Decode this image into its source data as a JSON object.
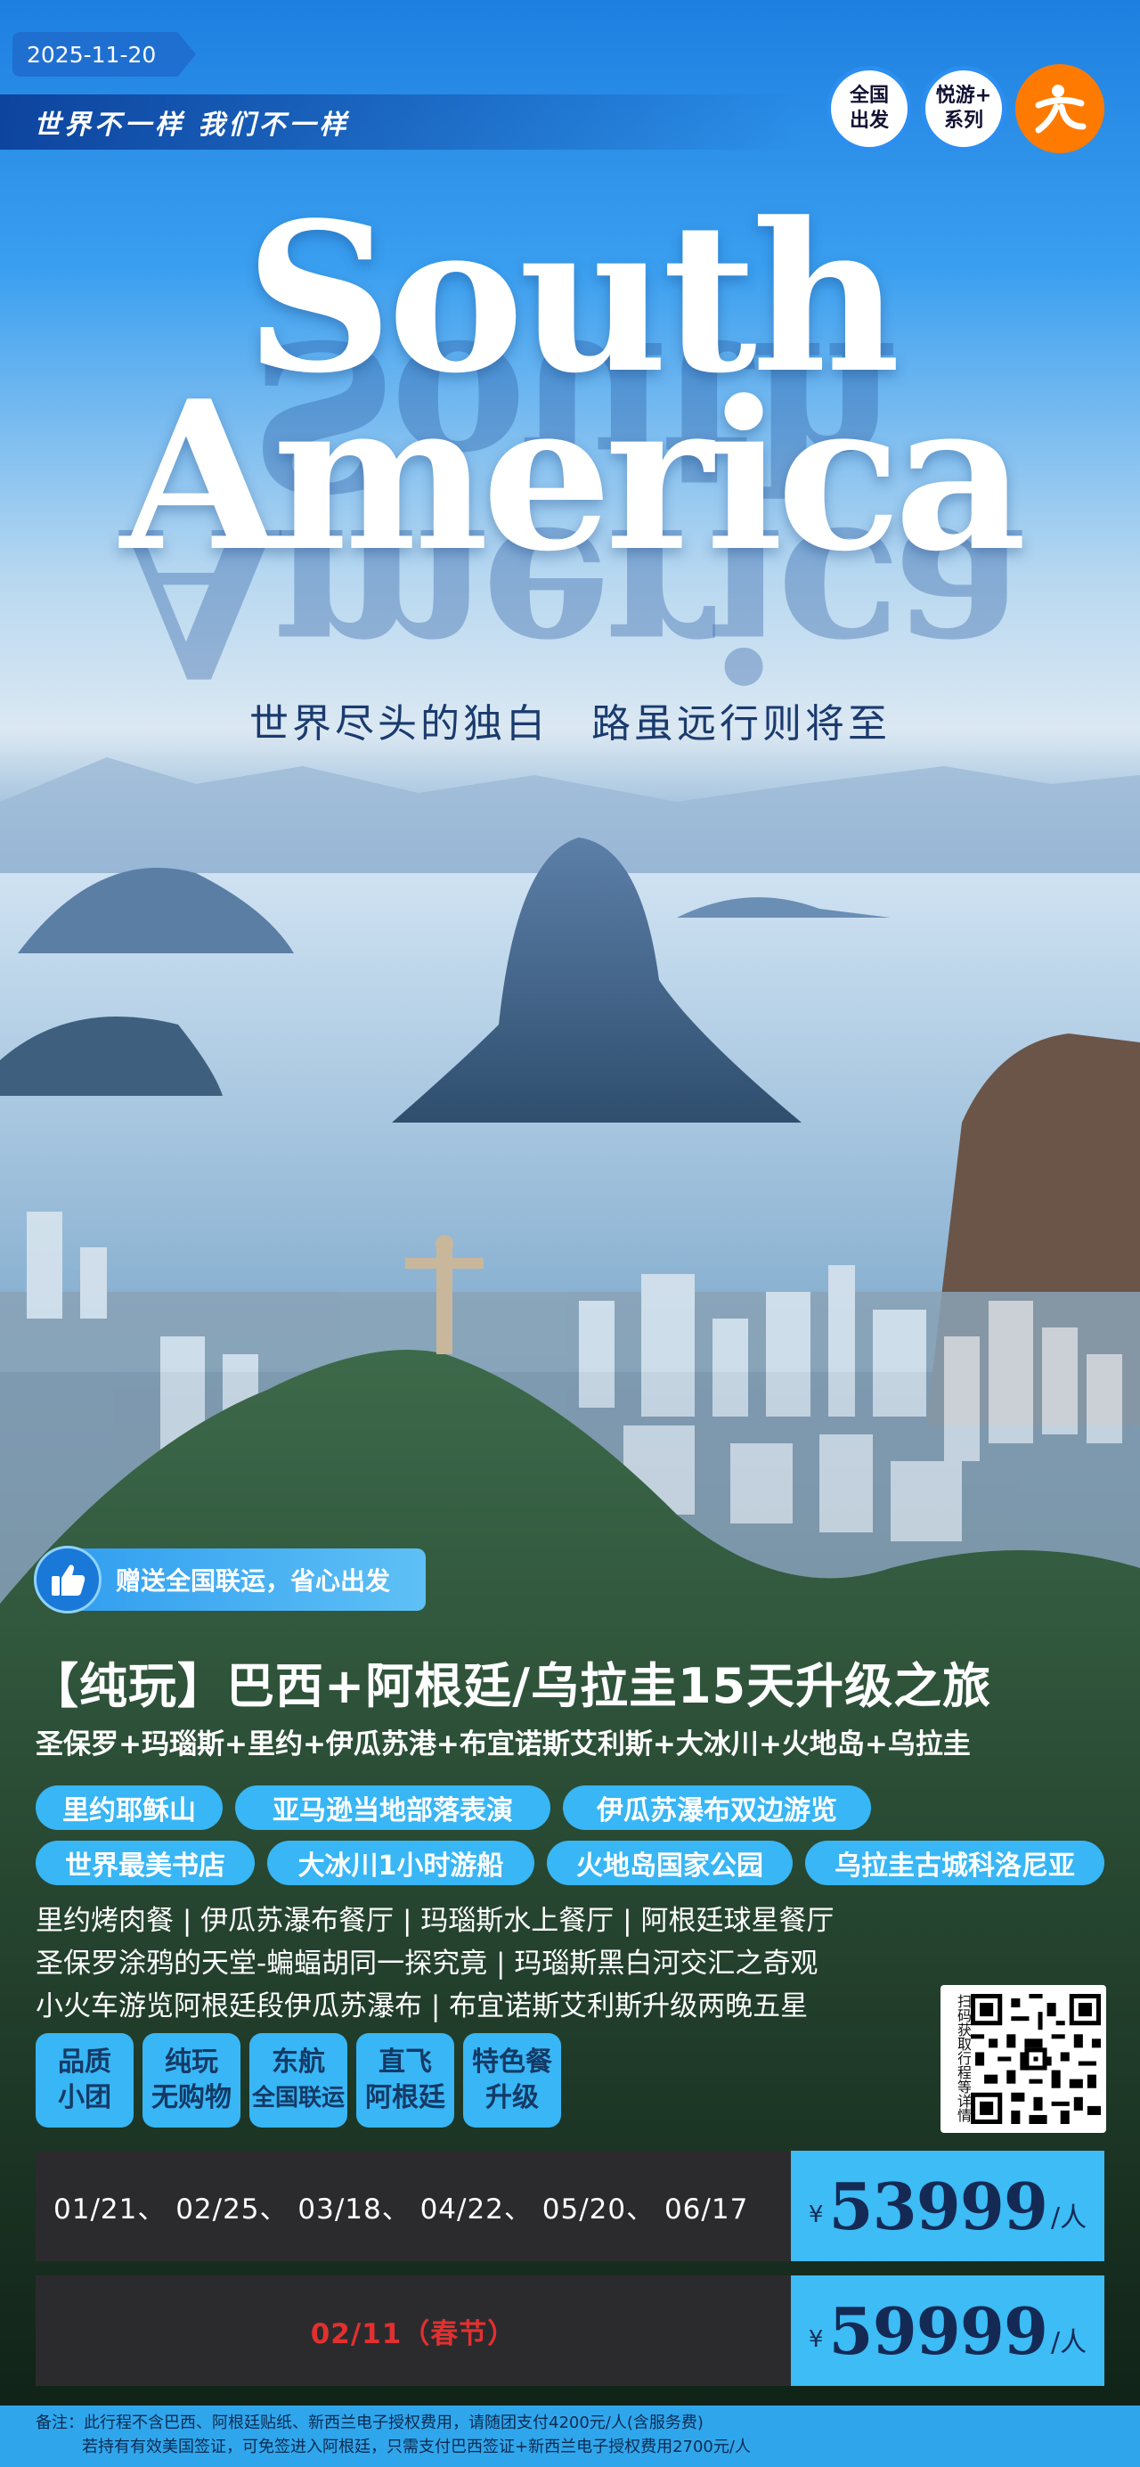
{
  "header": {
    "date": "2025-11-20",
    "slogan": "世界不一样  我们不一样",
    "badge1": "全国\n出发",
    "badge1_l1": "全国",
    "badge1_l2": "出发",
    "badge2_l1": "悦游+",
    "badge2_l2": "系列",
    "logo_icon": "brand-logo-icon"
  },
  "hero": {
    "title_line1": "South",
    "title_line2": "America",
    "subtitle": "世界尽头的独白　路虽远行则将至"
  },
  "promo": {
    "icon": "thumbs-up-icon",
    "text": "赠送全国联运，省心出发"
  },
  "product": {
    "title": "【纯玩】巴西+阿根廷/乌拉圭15天升级之旅",
    "route": "圣保罗+玛瑙斯+里约+伊瓜苏港+布宜诺斯艾利斯+大冰川+火地岛+乌拉圭"
  },
  "tags": [
    "里约耶稣山",
    "亚马逊当地部落表演",
    "伊瓜苏瀑布双边游览",
    "世界最美书店",
    "大冰川1小时游船",
    "火地岛国家公园",
    "乌拉圭古城科洛尼亚"
  ],
  "highlights": [
    "里约烤肉餐 | 伊瓜苏瀑布餐厅 | 玛瑙斯水上餐厅 | 阿根廷球星餐厅",
    "圣保罗涂鸦的天堂-蝙蝠胡同一探究竟 | 玛瑙斯黑白河交汇之奇观",
    "小火车游览阿根廷段伊瓜苏瀑布 | 布宜诺斯艾利斯升级两晚五星"
  ],
  "features": [
    {
      "l1": "品质",
      "l2": "小团"
    },
    {
      "l1": "纯玩",
      "l2": "无购物"
    },
    {
      "l1": "东航",
      "l2": "全国联运"
    },
    {
      "l1": "直飞",
      "l2": "阿根廷"
    },
    {
      "l1": "特色餐",
      "l2": "升级"
    }
  ],
  "qr": {
    "caption": "扫码获取行程等详情"
  },
  "prices": [
    {
      "dates": "01/21、  02/25、  03/18、  04/22、  05/20、  06/17",
      "yen": "¥",
      "amount": "53999",
      "per": "/人",
      "date_color": "#ffffff"
    },
    {
      "dates": "02/11（春节）",
      "yen": "¥",
      "amount": "59999",
      "per": "/人",
      "date_color": "#e23030"
    }
  ],
  "note": {
    "line1": "备注：此行程不含巴西、阿根廷贴纸、新西兰电子授权费用，请随团支付4200元/人(含服务费)",
    "line2": "若持有有效美国签证，可免签进入阿根廷，只需支付巴西签证+新西兰电子授权费用2700元/人"
  },
  "colors": {
    "accent": "#38b6f5",
    "brand_orange": "#ff7a00",
    "price_text": "#142a55"
  }
}
